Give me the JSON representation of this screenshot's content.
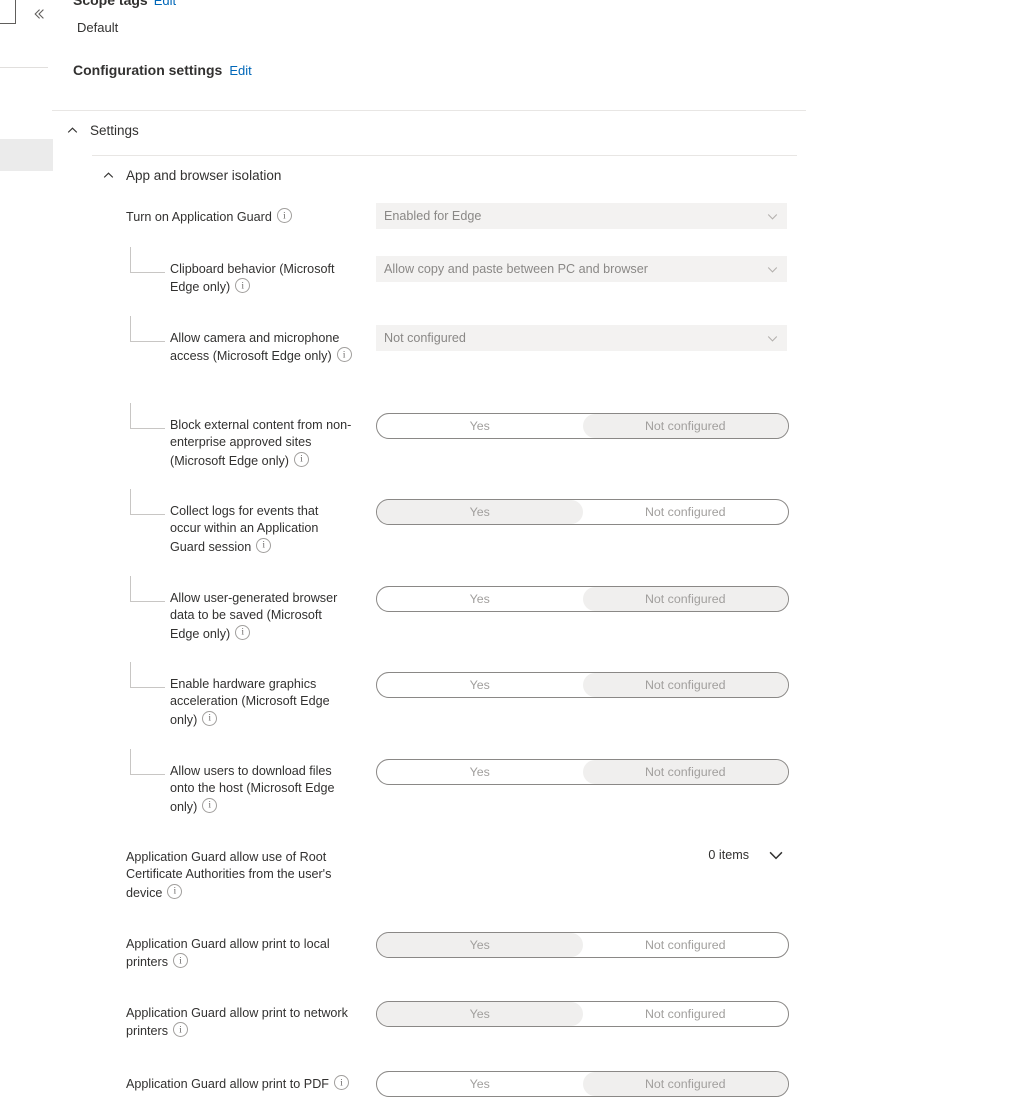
{
  "chrome": {
    "collapse_icon": "chevron-double-left-icon"
  },
  "meta": {
    "scope_tags_label": "Scope tags",
    "scope_tags_edit": "Edit",
    "scope_tags_value": "Default",
    "configuration_settings_label": "Configuration settings",
    "configuration_settings_edit": "Edit"
  },
  "accordions": [
    {
      "label": "Settings",
      "icon": "chevron-up-icon",
      "expanded": true
    },
    {
      "label": "App and browser isolation",
      "icon": "chevron-up-icon",
      "expanded": true
    }
  ],
  "toggle_options": {
    "yes": "Yes",
    "not_configured": "Not configured"
  },
  "settings": [
    {
      "label": "Turn on Application Guard",
      "indent": false,
      "control": "dropdown",
      "value": "Enabled for Edge",
      "info": true
    },
    {
      "label": "Clipboard behavior (Microsoft Edge only)",
      "indent": true,
      "control": "dropdown",
      "value": "Allow copy and paste between PC and browser",
      "info": true
    },
    {
      "label": "Allow camera and microphone access (Microsoft Edge only)",
      "indent": true,
      "control": "dropdown",
      "value": "Not configured",
      "info": true
    },
    {
      "label": "Block external content from non-enterprise approved sites (Microsoft Edge only)",
      "indent": true,
      "control": "toggle",
      "selected": "not_configured",
      "info": true
    },
    {
      "label": "Collect logs for events that occur within an Application Guard session",
      "indent": true,
      "control": "toggle",
      "selected": "yes",
      "info": true
    },
    {
      "label": "Allow user-generated browser data to be saved (Microsoft Edge only)",
      "indent": true,
      "control": "toggle",
      "selected": "not_configured",
      "info": true
    },
    {
      "label": "Enable hardware graphics acceleration (Microsoft Edge only)",
      "indent": true,
      "control": "toggle",
      "selected": "not_configured",
      "info": true
    },
    {
      "label": "Allow users to download files onto the host (Microsoft Edge only)",
      "indent": true,
      "control": "toggle",
      "selected": "not_configured",
      "info": true
    },
    {
      "label": "Application Guard allow use of Root Certificate Authorities from the user's device",
      "indent": false,
      "control": "items",
      "value": "0 items",
      "info": true
    },
    {
      "label": "Application Guard allow print to local printers",
      "indent": false,
      "control": "toggle",
      "selected": "yes",
      "info": true
    },
    {
      "label": "Application Guard allow print to network printers",
      "indent": false,
      "control": "toggle",
      "selected": "yes",
      "info": true
    },
    {
      "label": "Application Guard allow print to PDF",
      "indent": false,
      "control": "toggle",
      "selected": "not_configured",
      "info": true
    }
  ],
  "colors": {
    "link": "#0067b8",
    "text": "#323130",
    "muted": "#a19f9d",
    "field_bg": "#f3f2f1",
    "toggle_on_bg": "#f0efee",
    "border": "#8a8886",
    "divider": "#e8e6e4"
  }
}
